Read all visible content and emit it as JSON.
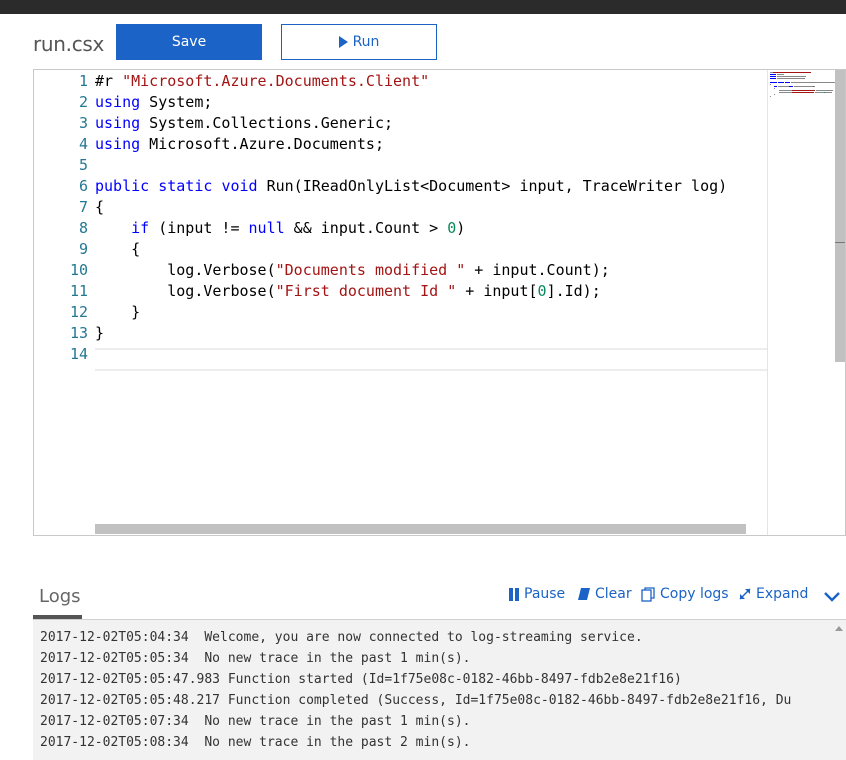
{
  "file": {
    "name": "run.csx"
  },
  "toolbar": {
    "save_label": "Save",
    "run_label": "Run"
  },
  "editor": {
    "line_numbers": [
      "1",
      "2",
      "3",
      "4",
      "5",
      "6",
      "7",
      "8",
      "9",
      "10",
      "11",
      "12",
      "13",
      "14"
    ],
    "code": [
      [
        {
          "t": "#r ",
          "c": ""
        },
        {
          "t": "\"Microsoft.Azure.Documents.Client\"",
          "c": "str"
        }
      ],
      [
        {
          "t": "using",
          "c": "kw"
        },
        {
          "t": " System;",
          "c": ""
        }
      ],
      [
        {
          "t": "using",
          "c": "kw"
        },
        {
          "t": " System.Collections.Generic;",
          "c": ""
        }
      ],
      [
        {
          "t": "using",
          "c": "kw"
        },
        {
          "t": " Microsoft.Azure.Documents;",
          "c": ""
        }
      ],
      [],
      [
        {
          "t": "public",
          "c": "kw"
        },
        {
          "t": " ",
          "c": ""
        },
        {
          "t": "static",
          "c": "kw"
        },
        {
          "t": " ",
          "c": ""
        },
        {
          "t": "void",
          "c": "kw"
        },
        {
          "t": " Run(IReadOnlyList<Document> input, TraceWriter log)",
          "c": ""
        }
      ],
      [
        {
          "t": "{",
          "c": ""
        }
      ],
      [
        {
          "t": "    ",
          "c": ""
        },
        {
          "t": "if",
          "c": "kw"
        },
        {
          "t": " (input != ",
          "c": ""
        },
        {
          "t": "null",
          "c": "kw"
        },
        {
          "t": " && input.Count > ",
          "c": ""
        },
        {
          "t": "0",
          "c": "num"
        },
        {
          "t": ")",
          "c": ""
        }
      ],
      [
        {
          "t": "    {",
          "c": ""
        }
      ],
      [
        {
          "t": "        log.Verbose(",
          "c": ""
        },
        {
          "t": "\"Documents modified \"",
          "c": "str"
        },
        {
          "t": " + input.Count);",
          "c": ""
        }
      ],
      [
        {
          "t": "        log.Verbose(",
          "c": ""
        },
        {
          "t": "\"First document Id \"",
          "c": "str"
        },
        {
          "t": " + input[",
          "c": ""
        },
        {
          "t": "0",
          "c": "num"
        },
        {
          "t": "].Id);",
          "c": ""
        }
      ],
      [
        {
          "t": "    }",
          "c": ""
        }
      ],
      [
        {
          "t": "}",
          "c": ""
        }
      ],
      []
    ]
  },
  "logs": {
    "title": "Logs",
    "actions": {
      "pause": "Pause",
      "clear": "Clear",
      "copy": "Copy logs",
      "expand": "Expand"
    },
    "lines": [
      "2017-12-02T05:04:34  Welcome, you are now connected to log-streaming service.",
      "2017-12-02T05:05:34  No new trace in the past 1 min(s).",
      "2017-12-02T05:05:47.983 Function started (Id=1f75e08c-0182-46bb-8497-fdb2e8e21f16)",
      "2017-12-02T05:05:48.217 Function completed (Success, Id=1f75e08c-0182-46bb-8497-fdb2e8e21f16, Du",
      "2017-12-02T05:07:34  No new trace in the past 1 min(s).",
      "2017-12-02T05:08:34  No new trace in the past 2 min(s)."
    ]
  },
  "colors": {
    "accent": "#1b63c6",
    "keyword": "#0000ff",
    "string": "#a31515",
    "number": "#09885a",
    "line_number": "#237893"
  }
}
